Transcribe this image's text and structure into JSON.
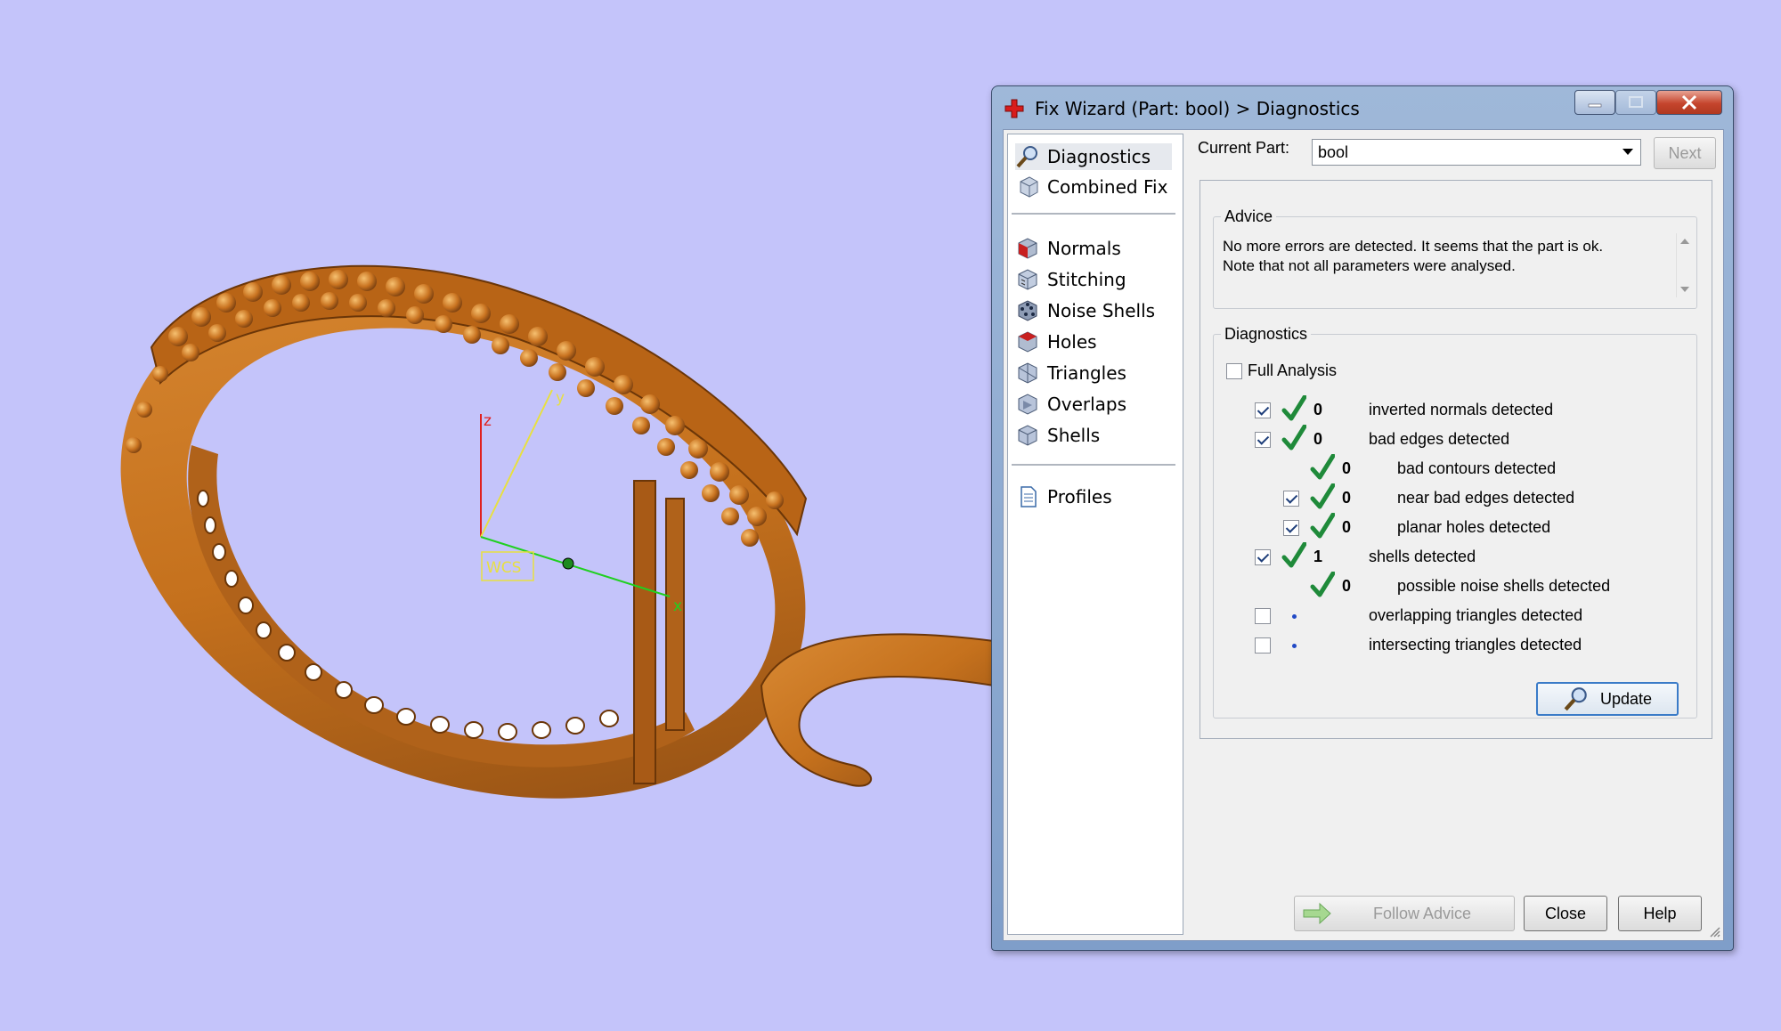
{
  "viewport": {
    "axis_labels": {
      "z": "z",
      "y": "y",
      "x": "x"
    },
    "wcs_label": "WCS",
    "colors": {
      "background": "#c4c4fa",
      "model": "#c5711d",
      "model_dark": "#8a4a12",
      "axis_z": "#e02020",
      "axis_y": "#e8e040",
      "axis_x": "#20d020"
    }
  },
  "window": {
    "title": "Fix Wizard (Part: bool) > Diagnostics",
    "icon": "red-cross-icon"
  },
  "nav": {
    "groups": [
      [
        {
          "label": "Diagnostics",
          "icon": "magnifier-icon"
        },
        {
          "label": "Combined Fix",
          "icon": "cube-icon"
        }
      ],
      [
        {
          "label": "Normals",
          "icon": "cube-red-face-icon"
        },
        {
          "label": "Stitching",
          "icon": "cube-stitch-icon"
        },
        {
          "label": "Noise Shells",
          "icon": "cube-dots-icon"
        },
        {
          "label": "Holes",
          "icon": "cube-red-icon"
        },
        {
          "label": "Triangles",
          "icon": "cube-triangle-icon"
        },
        {
          "label": "Overlaps",
          "icon": "cube-overlap-icon"
        },
        {
          "label": "Shells",
          "icon": "cube-shell-icon"
        }
      ],
      [
        {
          "label": "Profiles",
          "icon": "document-icon"
        }
      ]
    ]
  },
  "header": {
    "current_part_label": "Current Part:",
    "current_part_value": "bool",
    "next_label": "Next"
  },
  "advice": {
    "title": "Advice",
    "line1": "No more errors are detected. It seems that the part is ok.",
    "line2": "Note that not all parameters were analysed."
  },
  "diagnostics": {
    "title": "Diagnostics",
    "full_analysis_label": "Full Analysis",
    "full_analysis_checked": false,
    "rows": [
      {
        "checkbox": true,
        "checked": true,
        "status": "ok",
        "count": "0",
        "text": "inverted normals detected",
        "indent": 0
      },
      {
        "checkbox": true,
        "checked": true,
        "status": "ok",
        "count": "0",
        "text": "bad edges detected",
        "indent": 0
      },
      {
        "checkbox": false,
        "checked": false,
        "status": "ok",
        "count": "0",
        "text": "bad contours detected",
        "indent": 1
      },
      {
        "checkbox": true,
        "checked": true,
        "status": "ok",
        "count": "0",
        "text": "near bad edges detected",
        "indent": 1
      },
      {
        "checkbox": true,
        "checked": true,
        "status": "ok",
        "count": "0",
        "text": "planar holes detected",
        "indent": 1
      },
      {
        "checkbox": true,
        "checked": true,
        "status": "ok",
        "count": "1",
        "text": "shells detected",
        "indent": 0
      },
      {
        "checkbox": false,
        "checked": false,
        "status": "ok",
        "count": "0",
        "text": "possible noise shells detected",
        "indent": 1
      },
      {
        "checkbox": true,
        "checked": false,
        "status": "none",
        "count": "",
        "text": "overlapping triangles detected",
        "indent": 0
      },
      {
        "checkbox": true,
        "checked": false,
        "status": "none",
        "count": "",
        "text": "intersecting triangles detected",
        "indent": 0
      }
    ],
    "update_label": "Update"
  },
  "footer": {
    "follow_advice_label": "Follow Advice",
    "close_label": "Close",
    "help_label": "Help"
  }
}
